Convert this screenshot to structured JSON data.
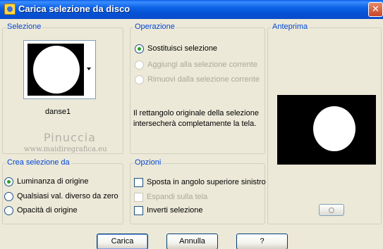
{
  "window": {
    "title": "Carica selezione da disco",
    "close_glyph": "✕"
  },
  "selection_group": {
    "label": "Selezione",
    "thumbnail_name": "danse1"
  },
  "watermark": {
    "name": "Pinuccia",
    "url": "www.maidiregrafica.eu"
  },
  "operation_group": {
    "label": "Operazione",
    "options": [
      {
        "label": "Sostituisci selezione",
        "checked": true,
        "enabled": true
      },
      {
        "label": "Aggiungi alla selezione corrente",
        "checked": false,
        "enabled": false
      },
      {
        "label": "Rimuovi dalla selezione corrente",
        "checked": false,
        "enabled": false
      }
    ],
    "description": "Il rettangolo originale della selezione intersecherà completamente la tela."
  },
  "preview_group": {
    "label": "Anteprima"
  },
  "create_group": {
    "label": "Crea selezione da",
    "options": [
      {
        "label": "Luminanza di origine",
        "checked": true
      },
      {
        "label": "Qualsiasi val. diverso da zero",
        "checked": false
      },
      {
        "label": "Opacità di origine",
        "checked": false
      }
    ]
  },
  "options_group": {
    "label": "Opzioni",
    "checkboxes": [
      {
        "label": "Sposta in angolo superiore sinistro",
        "checked": false,
        "enabled": true
      },
      {
        "label": "Espandi sulla tela",
        "checked": false,
        "enabled": false
      },
      {
        "label": "Inverti selezione",
        "checked": false,
        "enabled": true
      }
    ]
  },
  "buttons": {
    "load": "Carica",
    "cancel": "Annulla",
    "help": "?"
  },
  "colors": {
    "group_label": "#0046d5",
    "dialog_bg": "#ece9d8",
    "title_bar": "#0552d4"
  }
}
